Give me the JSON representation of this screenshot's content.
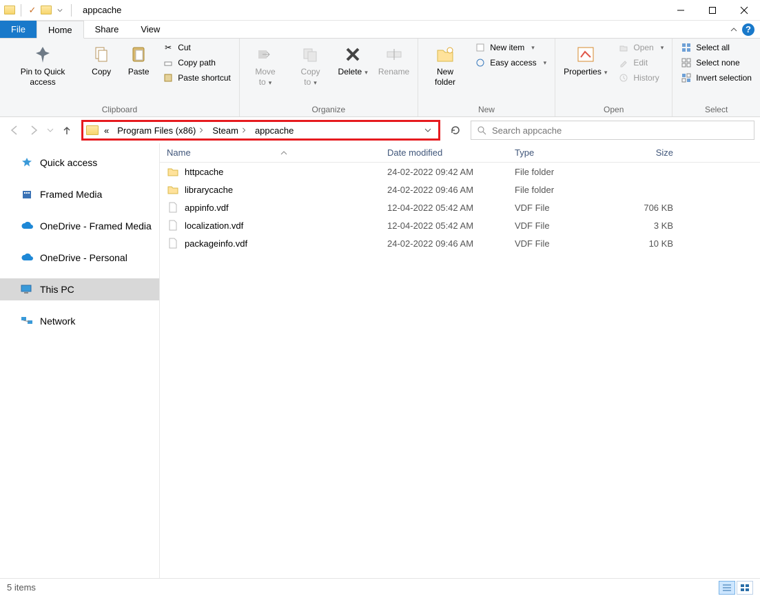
{
  "window_title": "appcache",
  "tabs": {
    "file": "File",
    "home": "Home",
    "share": "Share",
    "view": "View"
  },
  "ribbon": {
    "clipboard": {
      "label": "Clipboard",
      "pin": "Pin to Quick access",
      "copy": "Copy",
      "paste": "Paste",
      "cut": "Cut",
      "copy_path": "Copy path",
      "paste_shortcut": "Paste shortcut"
    },
    "organize": {
      "label": "Organize",
      "move_to": "Move to",
      "copy_to": "Copy to",
      "delete": "Delete",
      "rename": "Rename"
    },
    "new": {
      "label": "New",
      "new_folder": "New folder",
      "new_item": "New item",
      "easy_access": "Easy access"
    },
    "open": {
      "label": "Open",
      "properties": "Properties",
      "open": "Open",
      "edit": "Edit",
      "history": "History"
    },
    "select": {
      "label": "Select",
      "select_all": "Select all",
      "select_none": "Select none",
      "invert": "Invert selection"
    }
  },
  "breadcrumb": {
    "seg1": "Program Files (x86)",
    "seg2": "Steam",
    "seg3": "appcache"
  },
  "search": {
    "placeholder": "Search appcache"
  },
  "sidebar": {
    "quick_access": "Quick access",
    "framed_media": "Framed Media",
    "onedrive_framed": "OneDrive - Framed Media",
    "onedrive_personal": "OneDrive - Personal",
    "this_pc": "This PC",
    "network": "Network"
  },
  "columns": {
    "name": "Name",
    "date": "Date modified",
    "type": "Type",
    "size": "Size"
  },
  "files": [
    {
      "name": "httpcache",
      "date": "24-02-2022 09:42 AM",
      "type": "File folder",
      "size": "",
      "kind": "folder"
    },
    {
      "name": "librarycache",
      "date": "24-02-2022 09:46 AM",
      "type": "File folder",
      "size": "",
      "kind": "folder"
    },
    {
      "name": "appinfo.vdf",
      "date": "12-04-2022 05:42 AM",
      "type": "VDF File",
      "size": "706 KB",
      "kind": "file"
    },
    {
      "name": "localization.vdf",
      "date": "12-04-2022 05:42 AM",
      "type": "VDF File",
      "size": "3 KB",
      "kind": "file"
    },
    {
      "name": "packageinfo.vdf",
      "date": "24-02-2022 09:46 AM",
      "type": "VDF File",
      "size": "10 KB",
      "kind": "file"
    }
  ],
  "status": {
    "items": "5 items"
  }
}
